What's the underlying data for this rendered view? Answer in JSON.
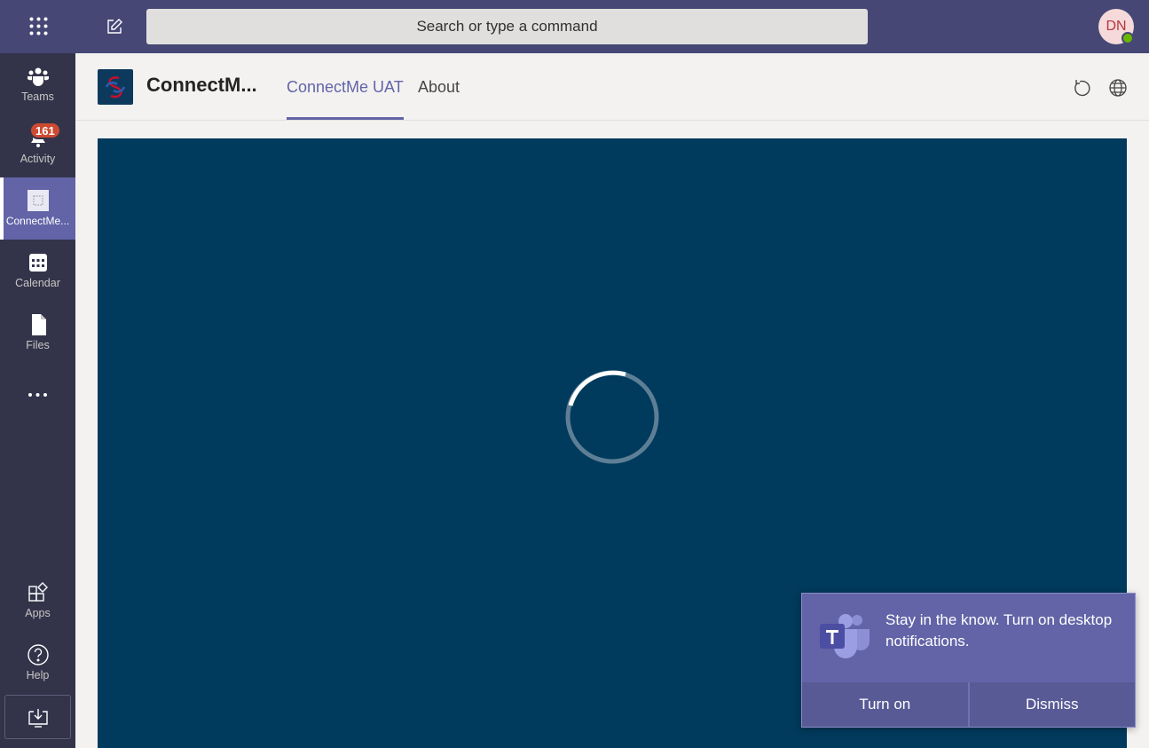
{
  "topbar": {
    "search_placeholder": "Search or type a command",
    "avatar_initials": "DN"
  },
  "rail": {
    "items": [
      {
        "label": "Teams"
      },
      {
        "label": "Activity",
        "badge": "161"
      },
      {
        "label": "ConnectMe..."
      },
      {
        "label": "Calendar"
      },
      {
        "label": "Files"
      }
    ],
    "apps_label": "Apps",
    "help_label": "Help"
  },
  "app": {
    "title": "ConnectM...",
    "tabs": [
      {
        "label": "ConnectMe UAT"
      },
      {
        "label": "About"
      }
    ]
  },
  "toast": {
    "message": "Stay in the know. Turn on desktop notifications.",
    "turn_on_label": "Turn on",
    "dismiss_label": "Dismiss"
  },
  "colors": {
    "topbar": "#464775",
    "rail": "#33344a",
    "accent": "#6264a7",
    "content_bg": "#003a5c",
    "badge": "#cc4a31"
  }
}
